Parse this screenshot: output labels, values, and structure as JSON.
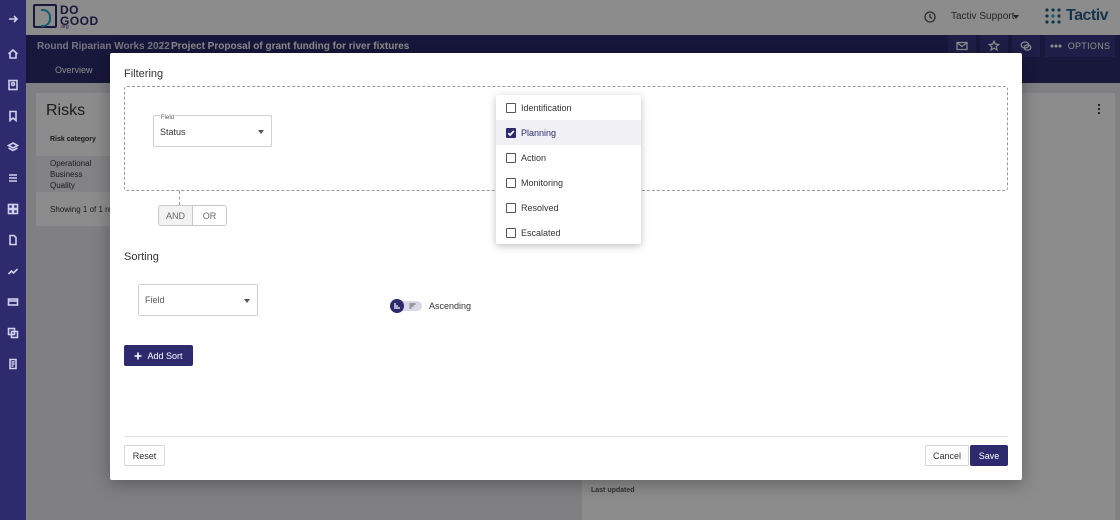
{
  "brand": {
    "logo_text_line1": "DO",
    "logo_text_line2": "GOOD",
    "logo_sub": ".org",
    "tactiv_label": "Tactiv"
  },
  "header": {
    "support_label": "Tactiv Support",
    "options_label": "OPTIONS"
  },
  "breadcrumb": {
    "parent": "Round Riparian Works 2022",
    "separator": "/",
    "current": "Project Proposal of grant funding for river fixtures"
  },
  "tabs": {
    "overview": "Overview"
  },
  "background": {
    "title": "Risks",
    "column_header": "Risk category",
    "row_values": [
      "Operational",
      "Business",
      "Quality"
    ],
    "showing": "Showing 1 of 1 re",
    "last_updated": "Last updated"
  },
  "modal": {
    "filtering_title": "Filtering",
    "filter_field_label": "Field",
    "filter_field_value": "Status",
    "and_label": "AND",
    "or_label": "OR",
    "status_options": [
      {
        "label": "Identification",
        "checked": false
      },
      {
        "label": "Planning",
        "checked": true
      },
      {
        "label": "Action",
        "checked": false
      },
      {
        "label": "Monitoring",
        "checked": false
      },
      {
        "label": "Resolved",
        "checked": false
      },
      {
        "label": "Escalated",
        "checked": false
      }
    ],
    "sorting_title": "Sorting",
    "sort_field_placeholder": "Field",
    "sort_direction_label": "Ascending",
    "add_sort_label": "Add Sort",
    "reset_label": "Reset",
    "cancel_label": "Cancel",
    "save_label": "Save"
  },
  "colors": {
    "primary": "#2d2a6e",
    "accent": "#26a7c9"
  }
}
